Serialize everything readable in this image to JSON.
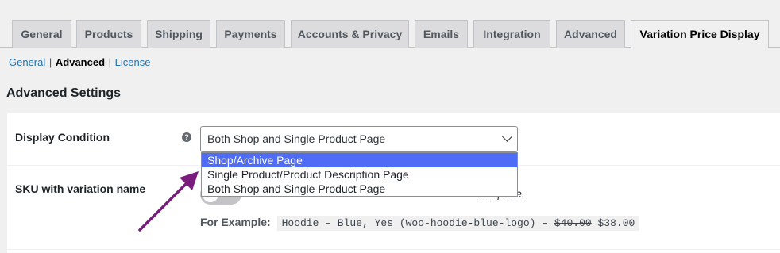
{
  "tabs": [
    {
      "label": "General"
    },
    {
      "label": "Products"
    },
    {
      "label": "Shipping"
    },
    {
      "label": "Payments"
    },
    {
      "label": "Accounts & Privacy"
    },
    {
      "label": "Emails"
    },
    {
      "label": "Integration"
    },
    {
      "label": "Advanced"
    },
    {
      "label": "Variation Price Display"
    }
  ],
  "subnav": {
    "general": "General",
    "advanced": "Advanced",
    "license": "License",
    "separator": "|"
  },
  "page_title": "Advanced Settings",
  "display_condition": {
    "label": "Display Condition",
    "help_icon": "?",
    "selected": "Both Shop and Single Product Page",
    "options": [
      "Shop/Archive Page",
      "Single Product/Product Description Page",
      "Both Shop and Single Product Page"
    ],
    "highlighted_option": "Shop/Archive Page"
  },
  "sku": {
    "label": "SKU with variation name",
    "description_visible": "ion price.",
    "example_label": "For Example:",
    "example_text": "Hoodie – Blue, Yes (woo-hoodie-blue-logo) – ",
    "example_old_price": "$40.00",
    "example_new_price": "$38.00"
  },
  "colors": {
    "highlight": "#4f6cf7",
    "arrow": "#7b1b7e",
    "link": "#2271b1"
  }
}
